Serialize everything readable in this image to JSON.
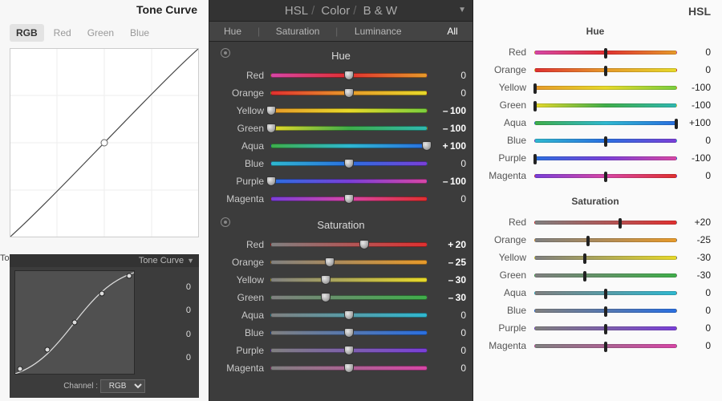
{
  "left": {
    "title": "Tone Curve",
    "tabs": [
      "RGB",
      "Red",
      "Green",
      "Blue"
    ],
    "active_tab": 0,
    "truncated_label": "To",
    "dark": {
      "title": "Tone Curve",
      "values": [
        "0",
        "0",
        "0",
        "0"
      ],
      "channel_label": "Channel :",
      "channel_value": "RGB"
    }
  },
  "mid": {
    "top": [
      "HSL",
      "Color",
      "B & W"
    ],
    "subtabs": [
      "Hue",
      "Saturation",
      "Luminance",
      "All"
    ],
    "active_sub": 3,
    "groups": [
      {
        "title": "Hue",
        "prefix": "g-",
        "rows": [
          {
            "label": "Red",
            "value": 0
          },
          {
            "label": "Orange",
            "value": 0
          },
          {
            "label": "Yellow",
            "value": -100
          },
          {
            "label": "Green",
            "value": -100
          },
          {
            "label": "Aqua",
            "value": 100
          },
          {
            "label": "Blue",
            "value": 0
          },
          {
            "label": "Purple",
            "value": -100
          },
          {
            "label": "Magenta",
            "value": 0
          }
        ]
      },
      {
        "title": "Saturation",
        "prefix": "s-",
        "rows": [
          {
            "label": "Red",
            "value": 20
          },
          {
            "label": "Orange",
            "value": -25
          },
          {
            "label": "Yellow",
            "value": -30
          },
          {
            "label": "Green",
            "value": -30
          },
          {
            "label": "Aqua",
            "value": 0
          },
          {
            "label": "Blue",
            "value": 0
          },
          {
            "label": "Purple",
            "value": 0
          },
          {
            "label": "Magenta",
            "value": 0
          }
        ]
      }
    ]
  },
  "right": {
    "title": "HSL",
    "groups": [
      {
        "title": "Hue",
        "prefix": "g-",
        "rows": [
          {
            "label": "Red",
            "value": 0
          },
          {
            "label": "Orange",
            "value": 0
          },
          {
            "label": "Yellow",
            "value": -100
          },
          {
            "label": "Green",
            "value": -100
          },
          {
            "label": "Aqua",
            "value": 100
          },
          {
            "label": "Blue",
            "value": 0
          },
          {
            "label": "Purple",
            "value": -100
          },
          {
            "label": "Magenta",
            "value": 0
          }
        ]
      },
      {
        "title": "Saturation",
        "prefix": "s-",
        "rows": [
          {
            "label": "Red",
            "value": 20
          },
          {
            "label": "Orange",
            "value": -25
          },
          {
            "label": "Yellow",
            "value": -30
          },
          {
            "label": "Green",
            "value": -30
          },
          {
            "label": "Aqua",
            "value": 0
          },
          {
            "label": "Blue",
            "value": 0
          },
          {
            "label": "Purple",
            "value": 0
          },
          {
            "label": "Magenta",
            "value": 0
          }
        ]
      }
    ]
  },
  "chart_data": {
    "type": "line",
    "title": "Tone Curve",
    "xlabel": "",
    "ylabel": "",
    "xlim": [
      0,
      255
    ],
    "ylim": [
      0,
      255
    ],
    "series": [
      {
        "name": "RGB (light panel)",
        "x": [
          0,
          128,
          255
        ],
        "y": [
          0,
          128,
          255
        ]
      },
      {
        "name": "RGB (dark panel)",
        "x": [
          0,
          64,
          128,
          192,
          255
        ],
        "y": [
          10,
          60,
          128,
          200,
          250
        ]
      }
    ]
  }
}
